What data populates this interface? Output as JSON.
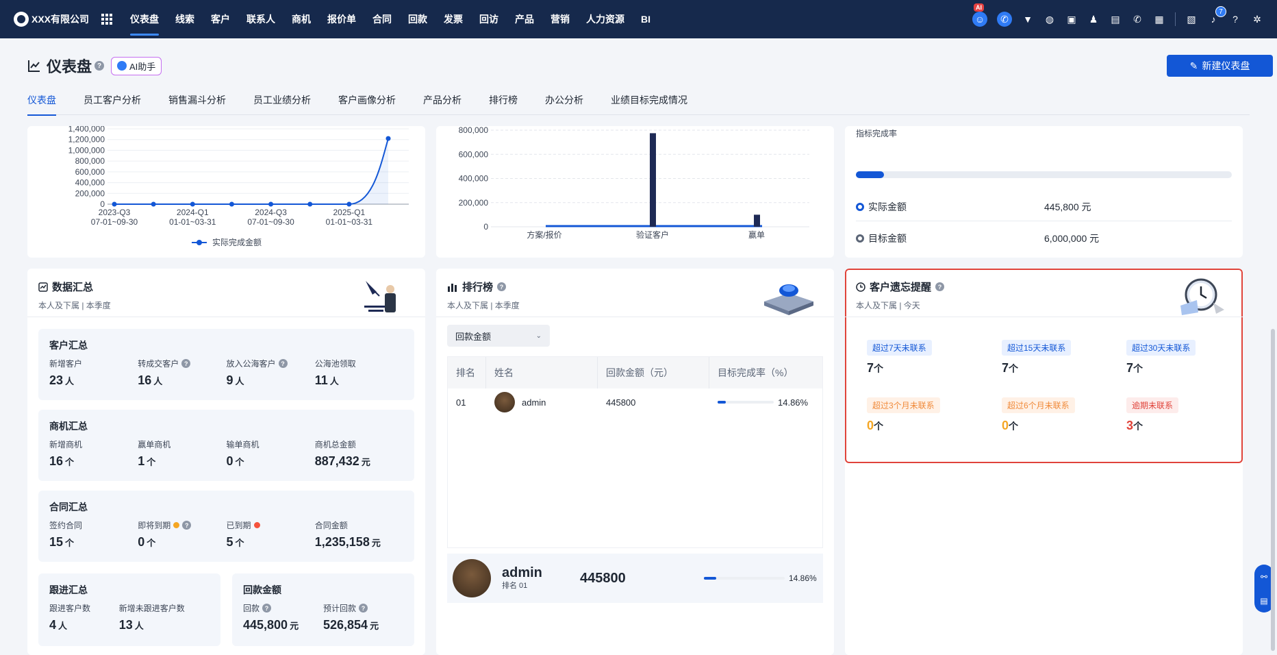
{
  "app": {
    "company": "XXX有限公司",
    "nav": [
      "仪表盘",
      "线索",
      "客户",
      "联系人",
      "商机",
      "报价单",
      "合同",
      "回款",
      "发票",
      "回访",
      "产品",
      "营销",
      "人力资源",
      "BI"
    ],
    "ai_badge": "AI",
    "notifications": "7"
  },
  "page": {
    "title": "仪表盘",
    "ai_helper": "AI助手",
    "new_button": "新建仪表盘",
    "tabs": [
      "仪表盘",
      "员工客户分析",
      "销售漏斗分析",
      "员工业绩分析",
      "客户画像分析",
      "产品分析",
      "排行榜",
      "办公分析",
      "业绩目标完成情况"
    ]
  },
  "chart_data": [
    {
      "type": "line",
      "x": [
        "2023-Q3\n07-01~09-30",
        "",
        "2024-Q1\n01-01~03-31",
        "",
        "2024-Q3\n07-01~09-30",
        "",
        "2025-Q1\n01-01~03-31",
        ""
      ],
      "series": [
        {
          "name": "实际完成金额",
          "values": [
            0,
            0,
            0,
            0,
            0,
            0,
            0,
            1220000
          ]
        }
      ],
      "ylim": [
        0,
        1400000
      ],
      "yticks": [
        "0",
        "200,000",
        "400,000",
        "600,000",
        "800,000",
        "1,000,000",
        "1,200,000",
        "1,400,000"
      ],
      "xticks": [
        [
          "2023-Q3",
          "07-01~09-30"
        ],
        [
          "2024-Q1",
          "01-01~03-31"
        ],
        [
          "2024-Q3",
          "07-01~09-30"
        ],
        [
          "2025-Q1",
          "01-01~03-31"
        ]
      ],
      "color": "#1357d6"
    },
    {
      "type": "bar",
      "categories": [
        "方案/报价",
        "验证客户",
        "赢单"
      ],
      "values": [
        0,
        775000,
        100000
      ],
      "ylim": [
        0,
        800000
      ],
      "yticks": [
        "0",
        "200,000",
        "400,000",
        "600,000",
        "800,000"
      ],
      "color": "#1e2a55"
    }
  ],
  "target": {
    "label": "指标完成率",
    "progress_pct": 7.4,
    "actual_label": "实际金额",
    "actual_value": "445,800 元",
    "target_label": "目标金额",
    "target_value": "6,000,000 元"
  },
  "summary": {
    "title": "数据汇总",
    "sub": "本人及下属 | 本季度",
    "customer": {
      "title": "客户汇总",
      "items": [
        {
          "label": "新增客户",
          "value": "23",
          "unit": "人"
        },
        {
          "label": "转成交客户",
          "value": "16",
          "unit": "人"
        },
        {
          "label": "放入公海客户",
          "value": "9",
          "unit": "人"
        },
        {
          "label": "公海池领取",
          "value": "11",
          "unit": "人"
        }
      ]
    },
    "opportunity": {
      "title": "商机汇总",
      "items": [
        {
          "label": "新增商机",
          "value": "16",
          "unit": "个"
        },
        {
          "label": "赢单商机",
          "value": "1",
          "unit": "个"
        },
        {
          "label": "输单商机",
          "value": "0",
          "unit": "个"
        },
        {
          "label": "商机总金额",
          "value": "887,432",
          "unit": "元"
        }
      ]
    },
    "contract": {
      "title": "合同汇总",
      "items": [
        {
          "label": "签约合同",
          "value": "15",
          "unit": "个"
        },
        {
          "label": "即将到期",
          "value": "0",
          "unit": "个"
        },
        {
          "label": "已到期",
          "value": "5",
          "unit": "个"
        },
        {
          "label": "合同金额",
          "value": "1,235,158",
          "unit": "元"
        }
      ]
    },
    "followup": {
      "title": "跟进汇总",
      "items": [
        {
          "label": "跟进客户数",
          "value": "4",
          "unit": "人"
        },
        {
          "label": "新增未跟进客户数",
          "value": "13",
          "unit": "人"
        }
      ]
    },
    "payment": {
      "title": "回款金额",
      "items": [
        {
          "label": "回款",
          "value": "445,800",
          "unit": "元"
        },
        {
          "label": "预计回款",
          "value": "526,854",
          "unit": "元"
        }
      ]
    }
  },
  "ranking": {
    "title": "排行榜",
    "sub": "本人及下属 | 本季度",
    "select": "回款金额",
    "headers": [
      "排名",
      "姓名",
      "回款金额（元）",
      "目标完成率（%）"
    ],
    "rows": [
      {
        "rank": "01",
        "name": "admin",
        "amount": "445800",
        "pct": "14.86%",
        "pct_value": 14.86
      }
    ],
    "me": {
      "name": "admin",
      "rank": "排名 01",
      "amount": "445800",
      "pct": "14.86%",
      "pct_value": 14.86
    }
  },
  "reminder": {
    "title": "客户遗忘提醒",
    "sub": "本人及下属 | 今天",
    "items": [
      {
        "label": "超过7天未联系",
        "value": "7",
        "unit": "个",
        "tone": "blue"
      },
      {
        "label": "超过15天未联系",
        "value": "7",
        "unit": "个",
        "tone": "blue"
      },
      {
        "label": "超过30天未联系",
        "value": "7",
        "unit": "个",
        "tone": "blue"
      },
      {
        "label": "超过3个月未联系",
        "value": "0",
        "unit": "个",
        "tone": "orange"
      },
      {
        "label": "超过6个月未联系",
        "value": "0",
        "unit": "个",
        "tone": "orange"
      },
      {
        "label": "逾期未联系",
        "value": "3",
        "unit": "个",
        "tone": "red"
      }
    ],
    "colors": {
      "blue": "#1f2733",
      "orange": "#f5a623",
      "red": "#e0433a",
      "highlight": "#e0433a"
    }
  }
}
